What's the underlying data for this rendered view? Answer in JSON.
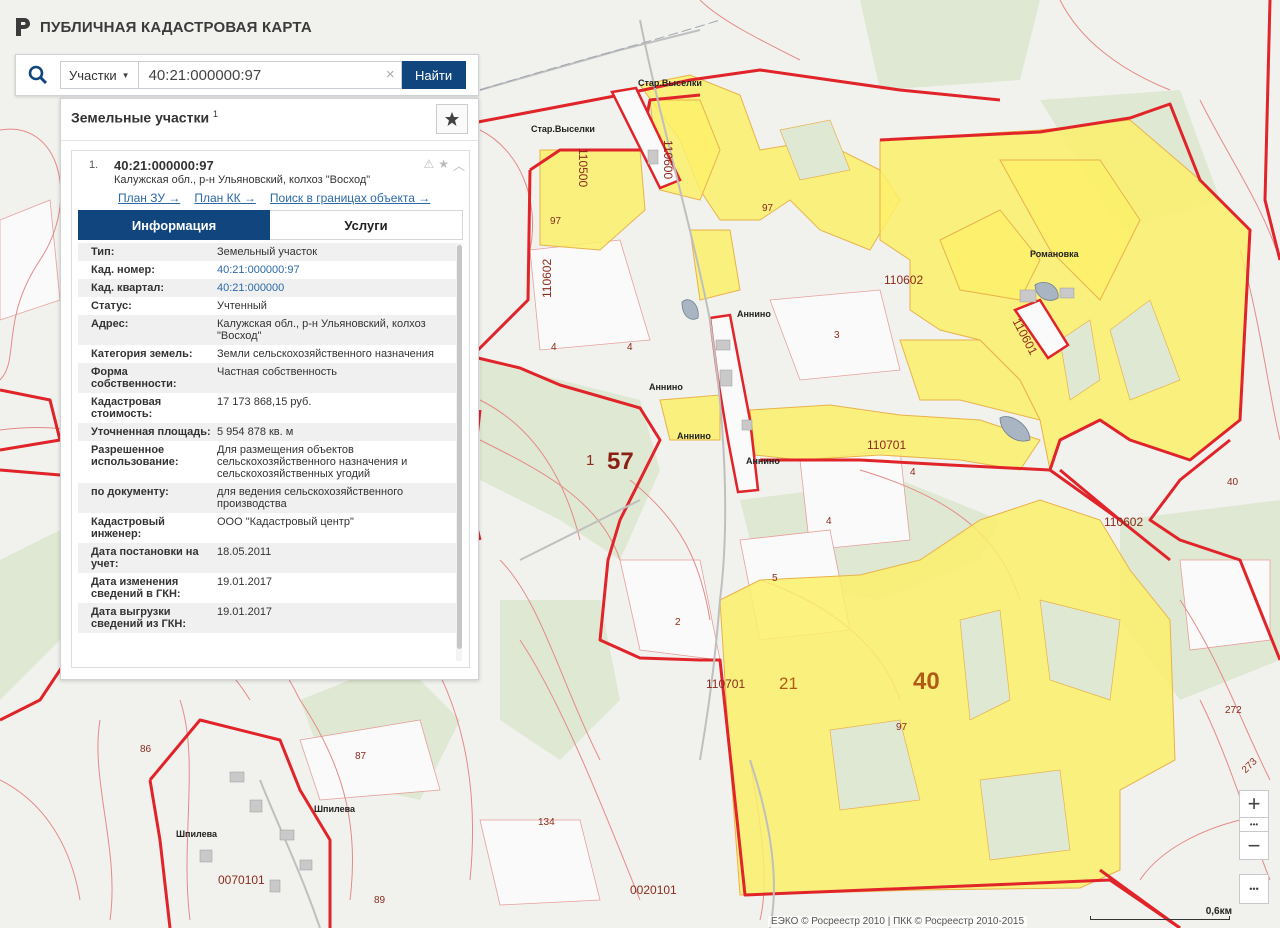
{
  "app": {
    "title": "ПУБЛИЧНАЯ КАДАСТРОВАЯ КАРТА"
  },
  "search": {
    "type_label": "Участки",
    "query": "40:21:000000:97",
    "find_label": "Найти",
    "clear_symbol": "×"
  },
  "panel": {
    "title": "Земельные участки",
    "count_sup": "1",
    "result": {
      "index": "1.",
      "cadastral_number": "40:21:000000:97",
      "address": "Калужская обл., р-н Ульяновский, колхоз \"Восход\"",
      "links": [
        "План ЗУ →",
        "План КК →",
        "Поиск в границах объекта →"
      ]
    },
    "tabs": [
      "Информация",
      "Услуги"
    ],
    "rows": [
      {
        "k": "Тип:",
        "v": "Земельный участок"
      },
      {
        "k": "Кад. номер:",
        "v": "40:21:000000:97"
      },
      {
        "k": "Кад. квартал:",
        "v": "40:21:000000"
      },
      {
        "k": "Статус:",
        "v": "Учтенный"
      },
      {
        "k": "Адрес:",
        "v": "Калужская обл., р-н Ульяновский, колхоз \"Восход\""
      },
      {
        "k": "Категория земель:",
        "v": "Земли сельскохозяйственного назначения"
      },
      {
        "k": "Форма собственности:",
        "v": "Частная собственность"
      },
      {
        "k": "Кадастровая стоимость:",
        "v": "17 173 868,15 руб."
      },
      {
        "k": "Уточненная площадь:",
        "v": "5 954 878 кв. м"
      },
      {
        "k": "Разрешенное использование:",
        "v": "Для размещения объектов сельскохозяйственного назначения и сельскохозяйственных угодий"
      },
      {
        "k": "по документу:",
        "v": "для ведения сельскохозяйственного производства"
      },
      {
        "k": "Кадастровый инженер:",
        "v": "ООО \"Кадастровый центр\""
      },
      {
        "k": "Дата постановки на учет:",
        "v": "18.05.2011"
      },
      {
        "k": "Дата изменения сведений в ГКН:",
        "v": "19.01.2017"
      },
      {
        "k": "Дата выгрузки сведений из ГКН:",
        "v": "19.01.2017"
      }
    ]
  },
  "map": {
    "colors": {
      "background": "#f1f2ee",
      "parcel_fill": "#fbf06a",
      "boundary": "#e0242a",
      "thin_boundary": "#e58a86",
      "forest": "#dfe8d2",
      "field": "#f8f8f8"
    },
    "labels": {
      "star_vyselki_1": "Стар.Выселки",
      "star_vyselki_2": "Стар.Выселки",
      "q110500": "110500",
      "q110600": "110600",
      "q110602_left": "110602",
      "q110602_mid": "110602",
      "q110601": "110601",
      "romanovka": "Романовка",
      "annino_1": "Аннино",
      "annino_2": "Аннино",
      "annino_3": "Аннино",
      "annino_4": "Аннино",
      "q110701_mid": "110701",
      "q110701_low": "110701",
      "q110602_right": "110602",
      "big57": "57",
      "big40": "40",
      "n21": "21",
      "n1": "1",
      "n97_a": "97",
      "n97_b": "97",
      "n97_c": "97",
      "n4_a": "4",
      "n4_b": "4",
      "n4_c": "4",
      "n4_d": "4",
      "n3": "3",
      "n5": "5",
      "n2": "2",
      "n40": "40",
      "n272": "272",
      "n273": "273",
      "n86": "86",
      "n87": "87",
      "n134": "134",
      "n89": "89",
      "shipileva_1": "Шпилева",
      "shipileva_2": "Шпилева",
      "q0070101": "0070101",
      "q0020101": "0020101"
    }
  },
  "zoom": {
    "in": "+",
    "out": "−",
    "more": "•••"
  },
  "attribution": "ЕЭКО © Росреестр 2010 | ПКК © Росреестр 2010-2015",
  "scale_label": "0,6км"
}
